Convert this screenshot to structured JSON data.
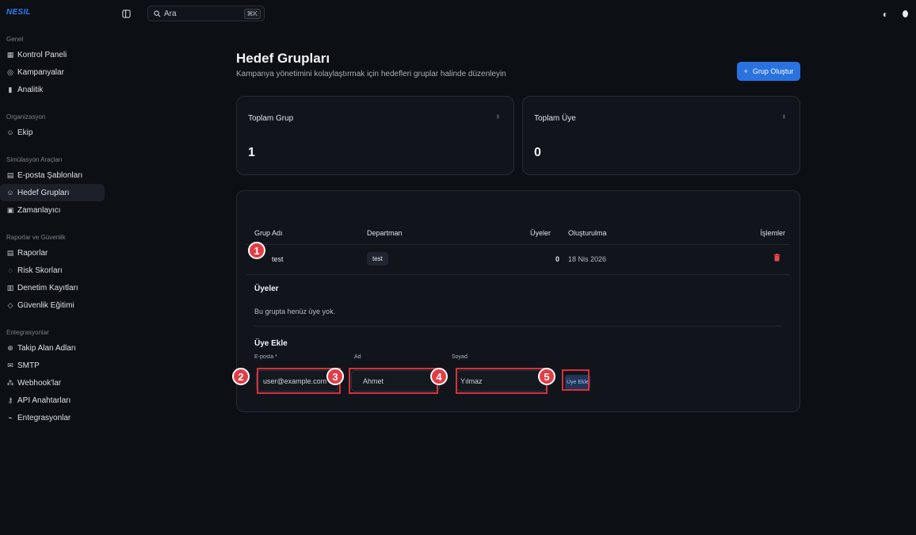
{
  "app": {
    "brand": "NESIL"
  },
  "topbar": {
    "search_placeholder": "Ara",
    "search_shortcut": "⌘K"
  },
  "sidebar": {
    "sections": [
      {
        "label": "Genel",
        "items": [
          {
            "label": "Kontrol Paneli",
            "icon": "grid-icon"
          },
          {
            "label": "Kampanyalar",
            "icon": "globe-icon"
          },
          {
            "label": "Analitik",
            "icon": "chart-icon"
          }
        ]
      },
      {
        "label": "Organizasyon",
        "items": [
          {
            "label": "Ekip",
            "icon": "users-icon"
          }
        ]
      },
      {
        "label": "Simülasyon Araçları",
        "items": [
          {
            "label": "E-posta Şablonları",
            "icon": "file-icon"
          },
          {
            "label": "Hedef Grupları",
            "icon": "users-icon",
            "active": true
          },
          {
            "label": "Zamanlayıcı",
            "icon": "calendar-icon"
          }
        ]
      },
      {
        "label": "Raporlar ve Güvenlik",
        "items": [
          {
            "label": "Raporlar",
            "icon": "file-icon"
          },
          {
            "label": "Risk Skorları",
            "icon": "shield-icon"
          },
          {
            "label": "Denetim Kayıtları",
            "icon": "book-icon"
          },
          {
            "label": "Güvenlik Eğitimi",
            "icon": "graduation-icon"
          }
        ]
      },
      {
        "label": "Entegrasyonlar",
        "items": [
          {
            "label": "Takip Alan Adları",
            "icon": "globe-icon"
          },
          {
            "label": "SMTP",
            "icon": "mail-icon"
          },
          {
            "label": "Webhook'lar",
            "icon": "webhook-icon"
          },
          {
            "label": "API Anahtarları",
            "icon": "key-icon"
          },
          {
            "label": "Entegrasyonlar",
            "icon": "plug-icon"
          }
        ]
      }
    ]
  },
  "page": {
    "title": "Hedef Grupları",
    "subtitle": "Kampanya yönetimini kolaylaştırmak için hedefleri gruplar halinde düzenleyin",
    "create_button": "Grup Oluştur"
  },
  "stats": [
    {
      "label": "Toplam Grup",
      "value": "1"
    },
    {
      "label": "Toplam Üye",
      "value": "0"
    }
  ],
  "table": {
    "headers": {
      "name": "Grup Adı",
      "department": "Departman",
      "members": "Üyeler",
      "created": "Oluşturulma",
      "actions": "İşlemler"
    },
    "rows": [
      {
        "name": "test",
        "department": "test",
        "members": "0",
        "created": "18 Nis 2026"
      }
    ]
  },
  "members": {
    "title": "Üyeler",
    "empty": "Bu grupta henüz üye yok.",
    "add_title": "Üye Ekle",
    "email_label": "E-posta *",
    "email_value": "user@example.com",
    "first_label": "Ad",
    "first_value": "Ahmet",
    "last_label": "Soyad",
    "last_value": "Yılmaz",
    "add_button": "Üye Ekle"
  },
  "annotations": [
    "1",
    "2",
    "3",
    "4",
    "5"
  ],
  "colors": {
    "accent": "#2a72e0",
    "marker": "#e23c45",
    "danger": "#e5484d"
  }
}
